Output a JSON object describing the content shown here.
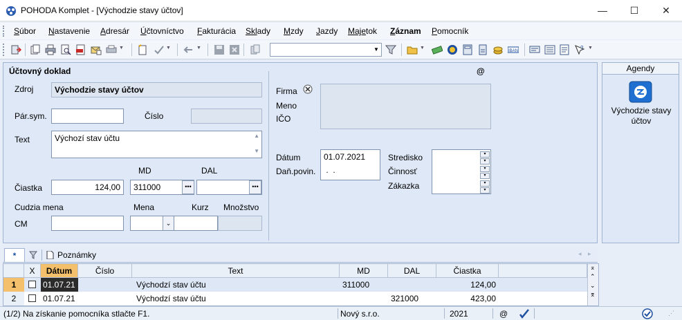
{
  "window": {
    "title": "POHODA Komplet - [Východzie stavy účtov]",
    "minimize": "—",
    "maximize": "☐",
    "close": "✕"
  },
  "menu": [
    {
      "u": "S",
      "rest": "úbor"
    },
    {
      "u": "N",
      "rest": "astavenie"
    },
    {
      "u": "A",
      "rest": "dresár"
    },
    {
      "u": "Ú",
      "rest": "čtovníctvo"
    },
    {
      "u": "F",
      "rest": "akturácia"
    },
    {
      "u": "Skl",
      "rest": "ady"
    },
    {
      "u": "M",
      "rest": "zdy"
    },
    {
      "u": "J",
      "rest": "azdy"
    },
    {
      "u": "Maje",
      "rest": "tok"
    },
    {
      "u": "Z",
      "rest": "áznam"
    },
    {
      "u": "P",
      "rest": "omocník"
    }
  ],
  "form": {
    "section_title": "Účtovný doklad",
    "at_sign": "@",
    "zdroj_label": "Zdroj",
    "zdroj_value": "Východzie stavy účtov",
    "parsym_label": "Pár.sym.",
    "parsym_value": "",
    "cislo_label": "Číslo",
    "cislo_value": "",
    "text_label": "Text",
    "text_value": "Výchozí stav účtu",
    "md_label": "MD",
    "dal_label": "DAL",
    "ciastka_label": "Čiastka",
    "ciastka_value": "124,00",
    "md_value": "311000",
    "dal_value": "",
    "cudzia_label": "Cudzia mena",
    "mena_label": "Mena",
    "kurz_label": "Kurz",
    "mnozstvo_label": "Množstvo",
    "cm_label": "CM",
    "cm_value": "",
    "firma_label": "Firma",
    "meno_label": "Meno",
    "ico_label": "IČO",
    "datum_label": "Dátum",
    "datum_value": "01.07.2021",
    "danpovin_label": "Daň.povin.",
    "danpovin_value": " .  .",
    "stredisko_label": "Stredisko",
    "cinnost_label": "Činnosť",
    "zakazka_label": "Zákazka"
  },
  "agendy": {
    "header": "Agendy",
    "item_label": "Východzie stavy účtov"
  },
  "tabs": {
    "star": "*",
    "notes": "Poznámky"
  },
  "grid": {
    "headers": [
      "",
      "X",
      "Dátum",
      "Číslo",
      "Text",
      "MD",
      "DAL",
      "Čiastka"
    ],
    "rows": [
      {
        "n": "1",
        "datum": "01.07.21",
        "cislo": "",
        "text": "Východzí stav účtu",
        "md": "311000",
        "dal": "",
        "ciastka": "124,00"
      },
      {
        "n": "2",
        "datum": "01.07.21",
        "cislo": "",
        "text": "Východzí stav účtu",
        "md": "",
        "dal": "321000",
        "ciastka": "423,00"
      }
    ]
  },
  "status": {
    "position": "(1/2) Na získanie pomocníka stlačte F1.",
    "company": "Nový s.r.o.",
    "year": "2021",
    "at": "@"
  }
}
